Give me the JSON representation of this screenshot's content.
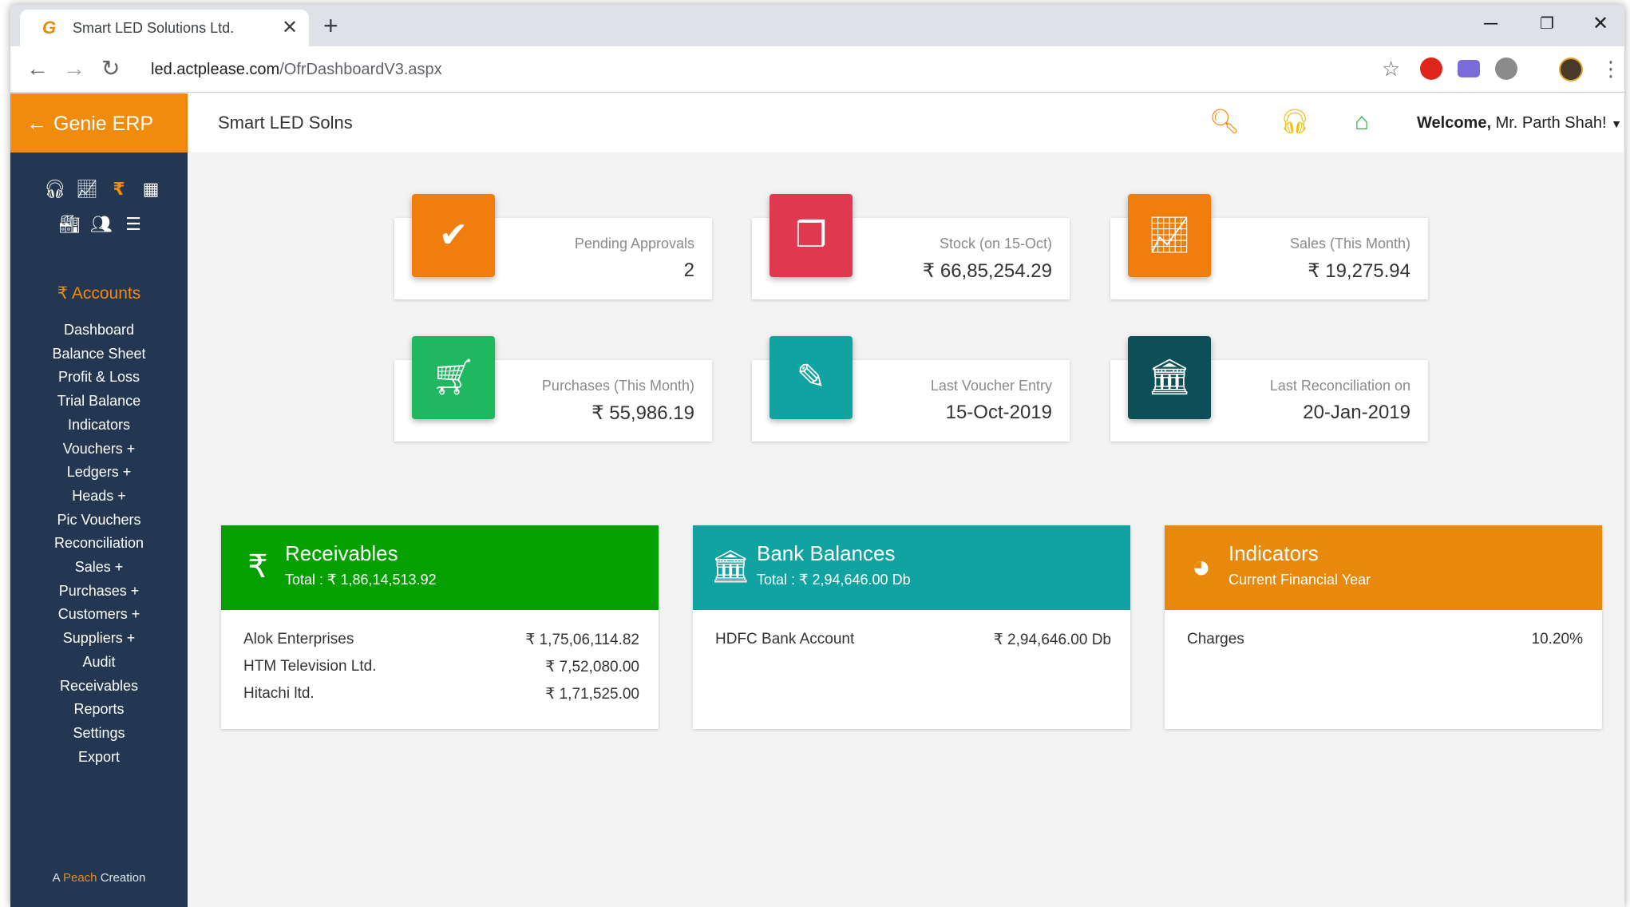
{
  "browser": {
    "tab_title": "Smart LED Solutions Ltd.",
    "tab_favicon": "G",
    "url_host": "led.actplease.com",
    "url_path": "/OfrDashboardV3.aspx"
  },
  "app": {
    "brand": "Genie ERP",
    "company": "Smart LED Solns",
    "welcome_prefix": "Welcome,",
    "welcome_user": "Mr. Parth Shah!",
    "colors": {
      "orange": "#f08b0e",
      "sidebar": "#243752",
      "green": "#04a000",
      "teal": "#10a3a2",
      "red": "#e0384f",
      "dark_teal": "#0c4f57"
    }
  },
  "sidebar": {
    "icons_row1": [
      "headset-icon",
      "chart-icon",
      "rupee-icon",
      "grid-icon"
    ],
    "icons_row2": [
      "factory-icon",
      "users-icon",
      "list-icon"
    ],
    "section_title": "Accounts",
    "menu": [
      "Dashboard",
      "Balance Sheet",
      "Profit & Loss",
      "Trial Balance",
      "Indicators",
      "Vouchers +",
      "Ledgers +",
      "Heads +",
      "Pic Vouchers",
      "Reconciliation",
      "Sales +",
      "Purchases +",
      "Customers +",
      "Suppliers +",
      "Audit",
      "Receivables",
      "Reports",
      "Settings",
      "Export"
    ],
    "credit_a": "A",
    "credit_peach": "Peach",
    "credit_creation": "Creation"
  },
  "stats": [
    {
      "label": "Pending Approvals",
      "value": "2",
      "icon": "double-check-icon",
      "color": "#f07d0c"
    },
    {
      "label": "Stock (on 15-Oct)",
      "value": "₹ 66,85,254.29",
      "icon": "cubes-icon",
      "color": "#e0384f"
    },
    {
      "label": "Sales (This Month)",
      "value": "₹ 19,275.94",
      "icon": "line-chart-icon",
      "color": "#f07d0c"
    },
    {
      "label": "Purchases (This Month)",
      "value": "₹ 55,986.19",
      "icon": "cart-icon",
      "color": "#1fb760"
    },
    {
      "label": "Last Voucher Entry",
      "value": "15-Oct-2019",
      "icon": "edit-icon",
      "color": "#10a3a2"
    },
    {
      "label": "Last Reconciliation on",
      "value": "20-Jan-2019",
      "icon": "bank-icon",
      "color": "#0c4f57"
    }
  ],
  "panels": {
    "receivables": {
      "title": "Receivables",
      "subtitle": "Total : ₹ 1,86,14,513.92",
      "rows": [
        {
          "name": "Alok Enterprises",
          "amount": "₹ 1,75,06,114.82"
        },
        {
          "name": "HTM Television Ltd.",
          "amount": "₹ 7,52,080.00"
        },
        {
          "name": "Hitachi ltd.",
          "amount": "₹ 1,71,525.00"
        }
      ]
    },
    "bank": {
      "title": "Bank Balances",
      "subtitle": "Total : ₹ 2,94,646.00 Db",
      "rows": [
        {
          "name": "HDFC Bank Account",
          "amount": "₹ 2,94,646.00 Db"
        }
      ]
    },
    "indicators": {
      "title": "Indicators",
      "subtitle": "Current Financial Year",
      "rows": [
        {
          "name": "Charges",
          "amount": "10.20%"
        }
      ]
    }
  }
}
